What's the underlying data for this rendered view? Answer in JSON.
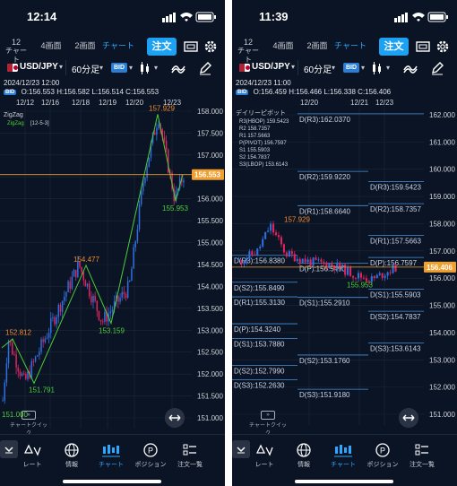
{
  "left": {
    "status_time": "12:14",
    "tabs": {
      "chart_num": "12",
      "chart_label": "チャート",
      "four": "4画面",
      "two": "2画面",
      "chart": "チャート"
    },
    "order_label": "注文",
    "symbol": "USD/JPY",
    "timeframe": "60分足",
    "price_type": "BID",
    "datetime": "2024/12/23 12:00",
    "ohlc": {
      "bid": "BID",
      "o": "O:156.553",
      "h": "H:156.582",
      "l": "L:156.514",
      "c": "C:156.553"
    },
    "date_labels": [
      "12/12",
      "12/16",
      "12/18",
      "12/19",
      "12/20",
      "12/23"
    ],
    "indicator_name": "ZigZag",
    "indicator_sub": "ZigZag",
    "indicator_params": "[12-5-3]",
    "price_axis": [
      "158.000",
      "157.500",
      "157.000",
      "156.500",
      "156.000",
      "155.500",
      "155.000",
      "154.500",
      "154.000",
      "153.500",
      "153.000",
      "152.500",
      "152.000",
      "151.500",
      "151.000"
    ],
    "current_price": "156.553",
    "zigzag_labels": [
      "157.929",
      "155.953",
      "154.477",
      "153.159",
      "152.812",
      "151.791",
      "151.000"
    ],
    "chart_quick": "チャートクイック"
  },
  "right": {
    "status_time": "11:39",
    "tabs": {
      "chart_num": "12",
      "chart_label": "チャート",
      "four": "4画面",
      "two": "2画面",
      "chart": "チャート"
    },
    "order_label": "注文",
    "symbol": "USD/JPY",
    "timeframe": "60分足",
    "price_type": "BID",
    "datetime": "2024/12/23 11:00",
    "ohlc": {
      "bid": "BID",
      "o": "O:156.459",
      "h": "H:156.466",
      "l": "L:156.338",
      "c": "C:156.406"
    },
    "date_labels": [
      "12/20",
      "12/21",
      "12/23"
    ],
    "indicator_name": "デイリーピボット",
    "pivot_legend": [
      "R3(HBOP)  159.5423",
      "R2  158.7357",
      "R1  157.5663",
      "P(PIVOT)  156.7597",
      "S1  155.5903",
      "S2  154.7837",
      "S3(LBOP)  153.6143"
    ],
    "price_axis": [
      "162.000",
      "161.000",
      "160.000",
      "159.000",
      "158.000",
      "157.000",
      "156.000",
      "155.000",
      "154.000",
      "153.000",
      "152.000",
      "151.000"
    ],
    "current_price": "156.406",
    "high_label": "157.929",
    "low_label": "155.953",
    "pivot_labels": [
      "D(R3):162.0370",
      "D(R2):159.9220",
      "D(R3):159.5423",
      "D(R1):158.6640",
      "D(R2):158.7357",
      "D(R1):157.5663",
      "D(R3):156.8380",
      "D(P):156.7597",
      "D(P):156.5490",
      "D(S1):155.5903",
      "D(S2):155.8490",
      "D(R1):155.3130",
      "D(S1):155.2910",
      "D(S2):154.7837",
      "D(P):154.3240",
      "D(S1):153.7880",
      "D(S3):153.6143",
      "D(S2):152.7990",
      "D(S2):153.1760",
      "D(S3):152.2630",
      "D(S3):151.9180"
    ],
    "chart_quick": "チャートクイック"
  },
  "nav": [
    {
      "label": "レート",
      "icon": "rate-icon"
    },
    {
      "label": "情報",
      "icon": "globe-icon"
    },
    {
      "label": "チャート",
      "icon": "candle-icon"
    },
    {
      "label": "ポジション",
      "icon": "position-icon"
    },
    {
      "label": "注文一覧",
      "icon": "order-list-icon"
    }
  ],
  "colors": {
    "bg": "#0b1424",
    "accent": "#2da7ff",
    "up": "#2f6fe0",
    "down": "#e0245e",
    "zigzag": "#4ccd3a",
    "price_line": "#f0a030",
    "pivot": "#4a8fd8"
  }
}
